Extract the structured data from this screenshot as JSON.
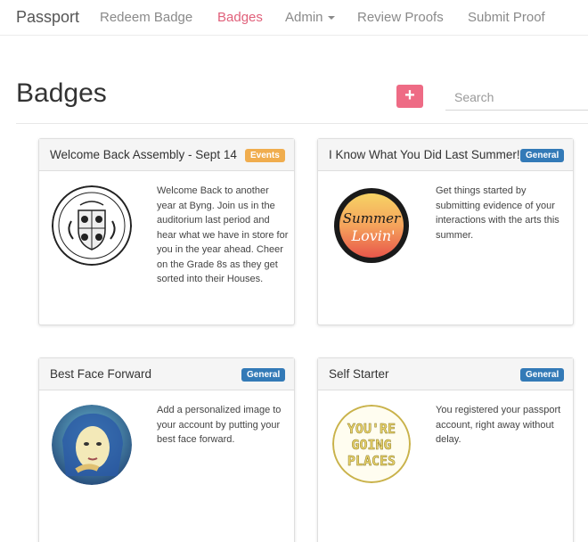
{
  "nav": {
    "brand": "Passport",
    "items": [
      {
        "label": "Redeem Badge",
        "active": false
      },
      {
        "label": "Badges",
        "active": true
      },
      {
        "label": "Admin",
        "active": false,
        "dropdown": true
      },
      {
        "label": "Review Proofs",
        "active": false
      },
      {
        "label": "Submit Proof",
        "active": false
      }
    ]
  },
  "page": {
    "title": "Badges",
    "add_button": "+",
    "search_placeholder": "Search"
  },
  "colors": {
    "accent": "#e0607a",
    "add_button": "#ee6b85",
    "events_label": "#f0ad4e",
    "general_label": "#337ab7"
  },
  "cards": [
    {
      "title": "Welcome Back Assembly - Sept 14",
      "category": "Events",
      "description": "Welcome Back to another year at Byng. Join us in the auditorium last period and hear what we have in store for you in the year ahead. Cheer on the Grade 8s as they get sorted into their Houses.",
      "image_icon": "crest-icon"
    },
    {
      "title": "I Know What You Did Last Summer!",
      "category": "General",
      "description": "Get things started by submitting evidence of your interactions with the arts this summer.",
      "image_icon": "summer-lovin-icon",
      "image_text": [
        "Summer",
        "Lovin'"
      ]
    },
    {
      "title": "Best Face Forward",
      "category": "General",
      "description": "Add a personalized image to your account by putting your best face forward.",
      "image_icon": "portrait-icon"
    },
    {
      "title": "Self Starter",
      "category": "General",
      "description": "You registered your passport account, right away without delay.",
      "image_icon": "youre-going-places-icon",
      "image_text": [
        "YOU'RE",
        "GOING",
        "PLACES"
      ]
    }
  ]
}
